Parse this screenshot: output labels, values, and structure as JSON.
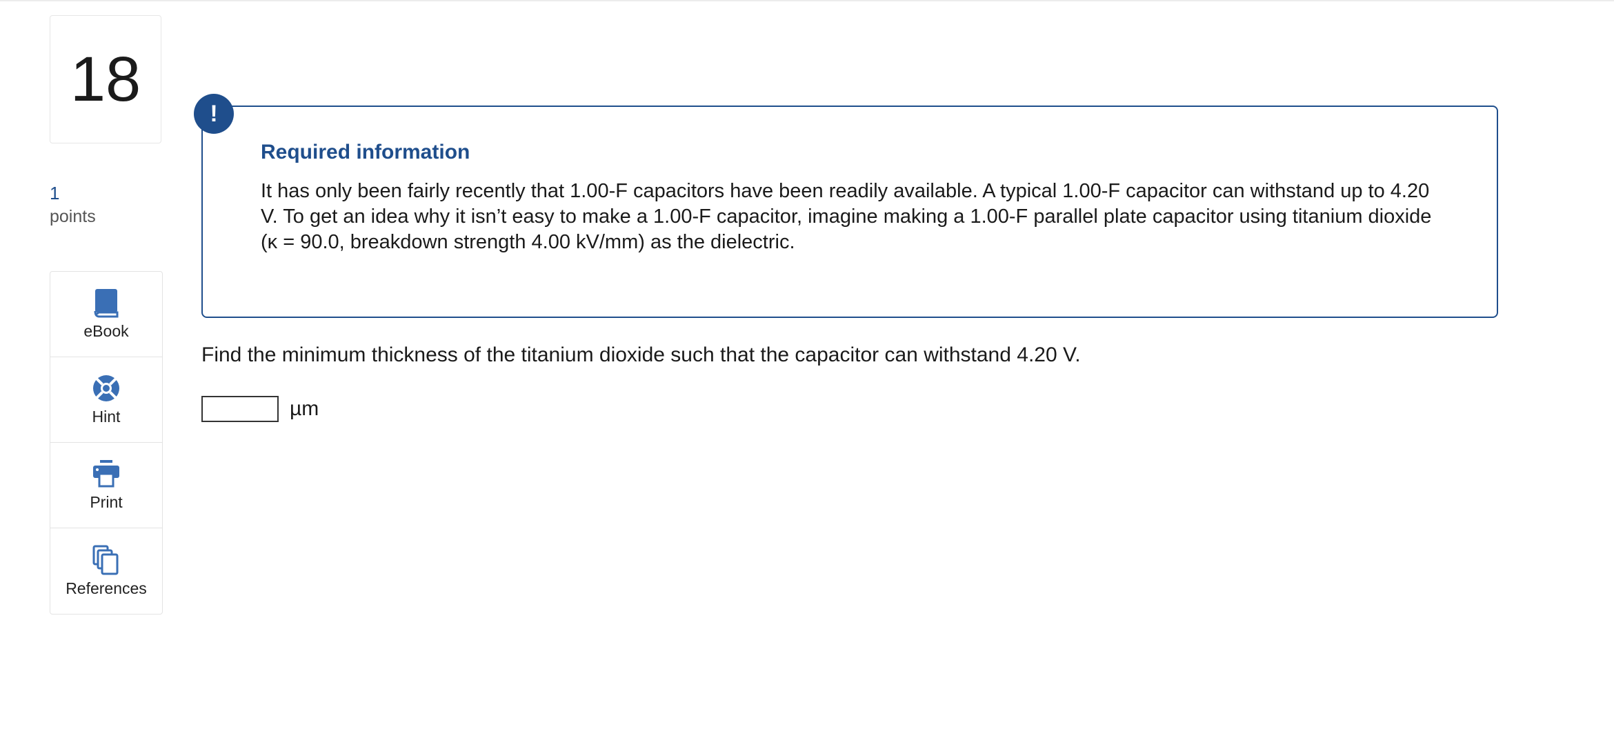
{
  "question": {
    "number": "18",
    "points_value": "1",
    "points_label": "points"
  },
  "tools": [
    {
      "label": "eBook",
      "icon": "book-icon"
    },
    {
      "label": "Hint",
      "icon": "lifebuoy-icon"
    },
    {
      "label": "Print",
      "icon": "printer-icon"
    },
    {
      "label": "References",
      "icon": "copy-icon"
    }
  ],
  "alert": {
    "badge": "!",
    "title": "Required information",
    "body": "It has only been fairly recently that 1.00-F capacitors have been readily available. A typical 1.00-F capacitor can withstand up to 4.20 V. To get an idea why it isn’t easy to make a 1.00-F capacitor, imagine making a 1.00-F parallel plate capacitor using titanium dioxide (κ = 90.0, breakdown strength 4.00 kV/mm) as the dielectric."
  },
  "prompt": "Find the minimum thickness of the titanium dioxide such that the capacitor can withstand 4.20 V.",
  "answer": {
    "value": "",
    "unit": "µm"
  },
  "colors": {
    "accent": "#1f4e8c",
    "icon": "#3a6fb5"
  }
}
